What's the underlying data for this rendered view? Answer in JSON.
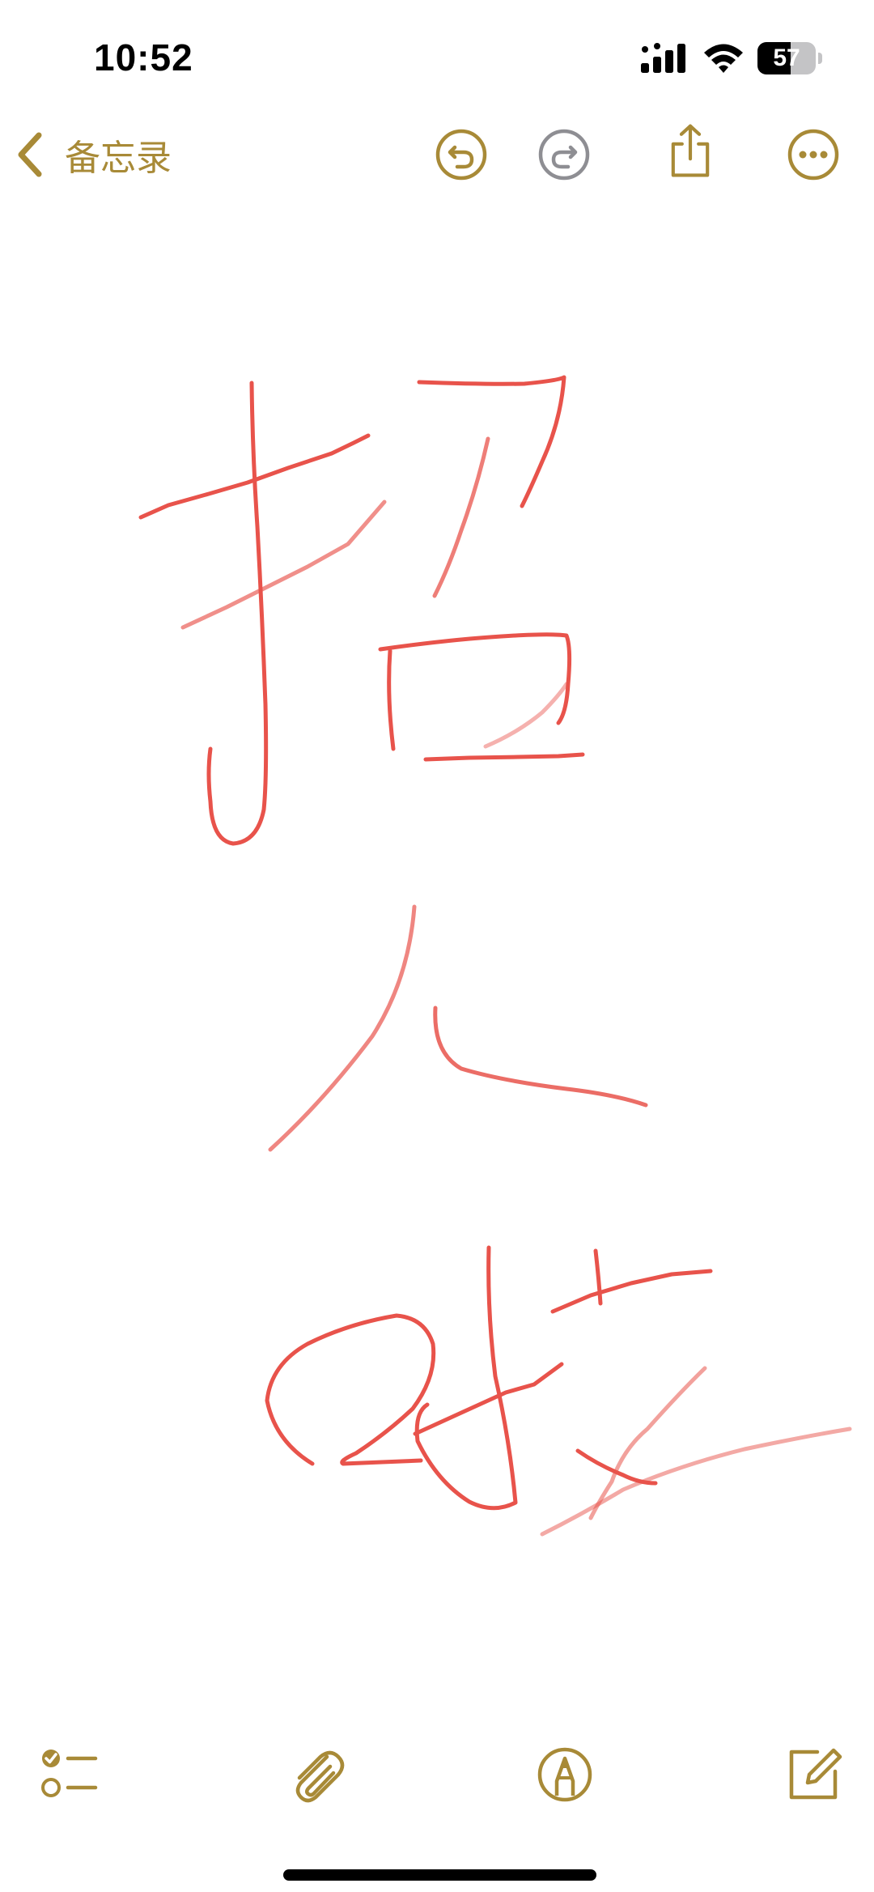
{
  "status_bar": {
    "time": "10:52",
    "battery_percent": "57",
    "battery_level": 0.57
  },
  "nav": {
    "back_label": "备忘录",
    "accent_color": "#a88a37",
    "undo_enabled": true,
    "redo_enabled": false
  },
  "canvas": {
    "ink_color": "#e8534b",
    "note_text": "招人啦"
  },
  "colors": {
    "accent": "#a88a37",
    "disabled": "#8e8e93",
    "ink": "#e8534b"
  },
  "icons": {
    "back": "chevron-left-icon",
    "undo": "undo-icon",
    "redo": "redo-icon",
    "share": "share-icon",
    "more": "ellipsis-circle-icon",
    "checklist": "checklist-icon",
    "attachment": "paperclip-icon",
    "markup": "markup-pen-icon",
    "compose": "compose-icon"
  }
}
